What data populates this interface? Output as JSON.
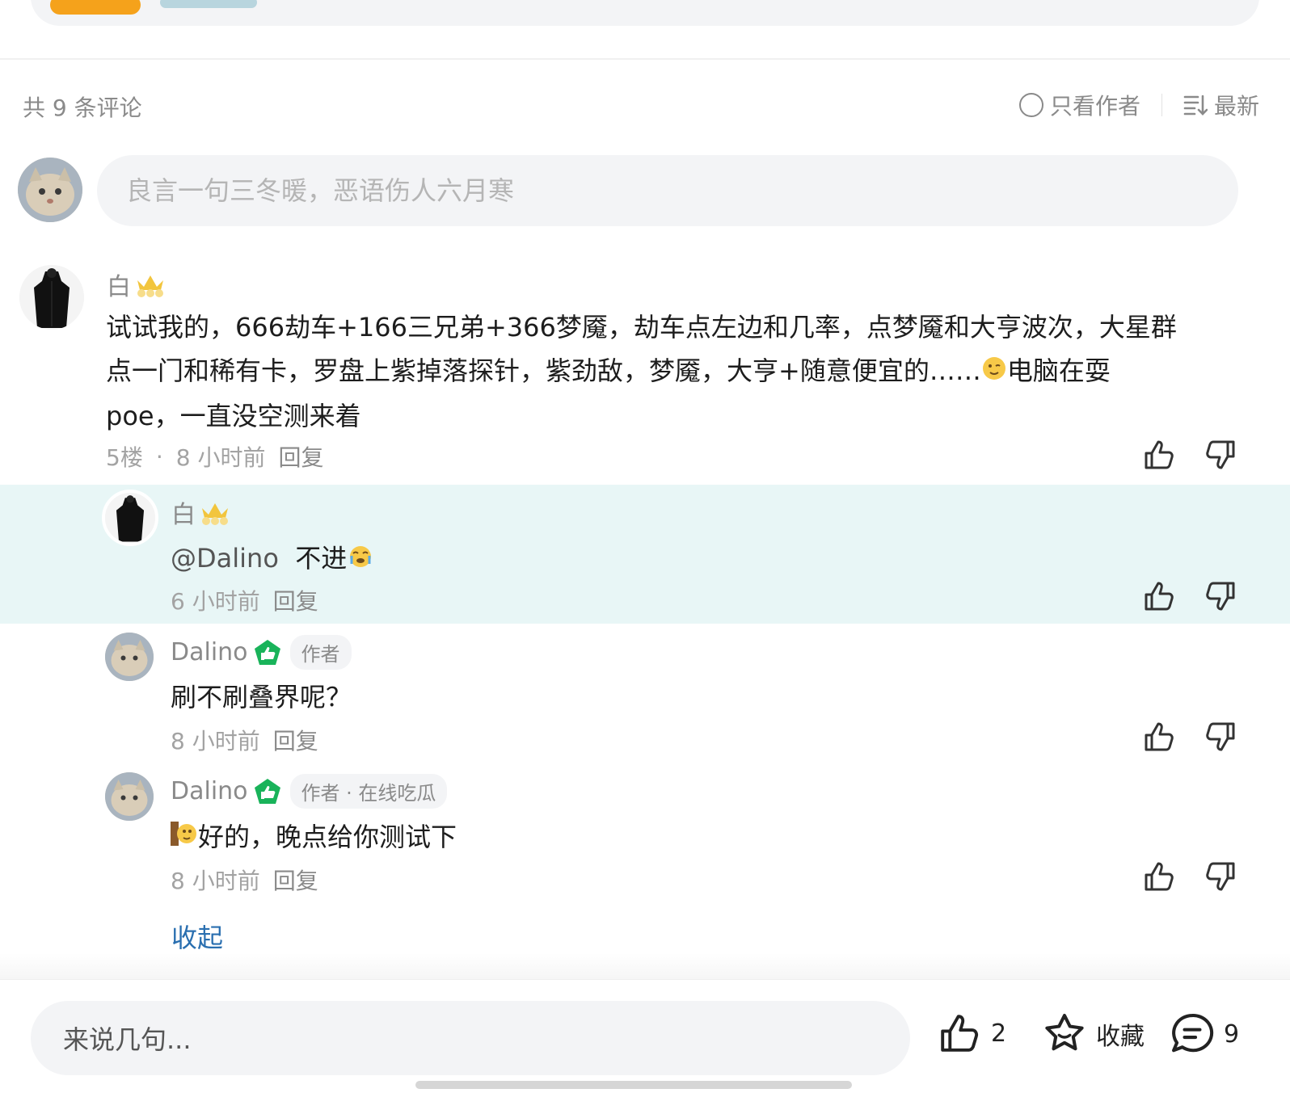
{
  "header": {
    "comment_count": "共 9 条评论",
    "only_author": "只看作者",
    "sort_label": "最新"
  },
  "composer": {
    "placeholder": "良言一句三冬暖，恶语伤人六月寒"
  },
  "comments": [
    {
      "name": "白",
      "text_line1": "试试我的，666劫车+166三兄弟+366梦魇，劫车点左边和几率，点梦魇和大亨波次，大星群",
      "text_line2a": "点一门和稀有卡，罗盘上紫掉落探针，紫劲敌，梦魇，大亨+随意便宜的……",
      "text_line2b": "电脑在耍",
      "text_line3": "poe，一直没空测来着",
      "floor": "5楼",
      "dot": "·",
      "time": "8 小时前",
      "reply": "回复"
    }
  ],
  "replies": [
    {
      "name": "白",
      "mention": "@Dalino",
      "text": "不进",
      "time": "6 小时前",
      "reply": "回复"
    },
    {
      "name": "Dalino",
      "tag": "作者",
      "text": "刷不刷叠界呢？",
      "time": "8 小时前",
      "reply": "回复"
    },
    {
      "name": "Dalino",
      "tag": "作者 · 在线吃瓜",
      "text": "好的，晚点给你测试下",
      "time": "8 小时前",
      "reply": "回复"
    }
  ],
  "collapse_label": "收起",
  "bottom_bar": {
    "input_placeholder": "来说几句...",
    "like_count": "2",
    "favorite_label": "收藏",
    "comment_count": "9"
  },
  "colors": {
    "highlight_bg": "#e8f6f6",
    "link_blue": "#2a6fb0",
    "badge_green": "#19b35a",
    "muted_text": "#8a8a8a"
  }
}
